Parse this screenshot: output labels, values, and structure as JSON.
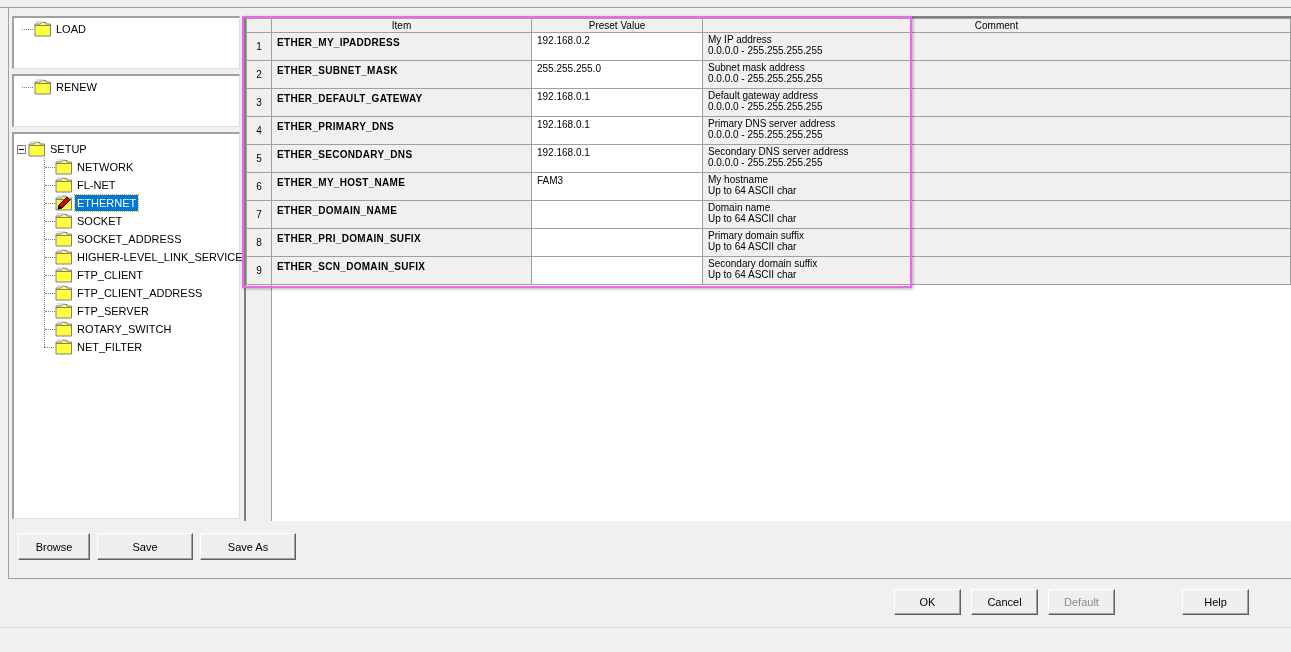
{
  "load_tree": [
    {
      "label": "LOAD",
      "selected": false,
      "edited": false
    }
  ],
  "renew_tree": [
    {
      "label": "RENEW",
      "selected": false,
      "edited": false
    }
  ],
  "setup_tree": {
    "label": "SETUP",
    "expanded": true,
    "selected": false,
    "edited": false,
    "children": [
      {
        "label": "NETWORK",
        "selected": false,
        "edited": false
      },
      {
        "label": "FL-NET",
        "selected": false,
        "edited": false
      },
      {
        "label": "ETHERNET",
        "selected": true,
        "edited": true
      },
      {
        "label": "SOCKET",
        "selected": false,
        "edited": false
      },
      {
        "label": "SOCKET_ADDRESS",
        "selected": false,
        "edited": false
      },
      {
        "label": "HIGHER-LEVEL_LINK_SERVICE",
        "selected": false,
        "edited": false
      },
      {
        "label": "FTP_CLIENT",
        "selected": false,
        "edited": false
      },
      {
        "label": "FTP_CLIENT_ADDRESS",
        "selected": false,
        "edited": false
      },
      {
        "label": "FTP_SERVER",
        "selected": false,
        "edited": false
      },
      {
        "label": "ROTARY_SWITCH",
        "selected": false,
        "edited": false
      },
      {
        "label": "NET_FILTER",
        "selected": false,
        "edited": false
      }
    ]
  },
  "table": {
    "highlighted": true,
    "columns": [
      "Item",
      "Preset Value",
      "Comment"
    ],
    "rows": [
      {
        "number": "1",
        "item": "ETHER_MY_IPADDRESS",
        "value": "192.168.0.2",
        "comment": "My IP address\n0.0.0.0 - 255.255.255.255"
      },
      {
        "number": "2",
        "item": "ETHER_SUBNET_MASK",
        "value": "255.255.255.0",
        "comment": "Subnet mask address\n0.0.0.0 - 255.255.255.255"
      },
      {
        "number": "3",
        "item": "ETHER_DEFAULT_GATEWAY",
        "value": "192.168.0.1",
        "comment": "Default gateway address\n0.0.0.0 - 255.255.255.255"
      },
      {
        "number": "4",
        "item": "ETHER_PRIMARY_DNS",
        "value": "192.168.0.1",
        "comment": "Primary DNS server address\n0.0.0.0 - 255.255.255.255"
      },
      {
        "number": "5",
        "item": "ETHER_SECONDARY_DNS",
        "value": "192.168.0.1",
        "comment": "Secondary DNS server address\n0.0.0.0 - 255.255.255.255"
      },
      {
        "number": "6",
        "item": "ETHER_MY_HOST_NAME",
        "value": "FAM3",
        "comment": "My hostname\nUp to 64 ASCII char"
      },
      {
        "number": "7",
        "item": "ETHER_DOMAIN_NAME",
        "value": "",
        "comment": "Domain name\nUp to 64 ASCII char"
      },
      {
        "number": "8",
        "item": "ETHER_PRI_DOMAIN_SUFIX",
        "value": "",
        "comment": "Primary domain suffix\nUp to 64 ASCII char"
      },
      {
        "number": "9",
        "item": "ETHER_SCN_DOMAIN_SUFIX",
        "value": "",
        "comment": "Secondary domain suffix\nUp to 64 ASCII char"
      }
    ]
  },
  "file_buttons": [
    {
      "label": "Browse",
      "disabled": false
    },
    {
      "label": "Save",
      "disabled": false
    },
    {
      "label": "Save As",
      "disabled": false
    }
  ],
  "dialog_buttons": [
    {
      "label": "OK",
      "disabled": false
    },
    {
      "label": "Cancel",
      "disabled": false
    },
    {
      "label": "Default",
      "disabled": true
    },
    {
      "label": "Help",
      "disabled": false
    }
  ]
}
